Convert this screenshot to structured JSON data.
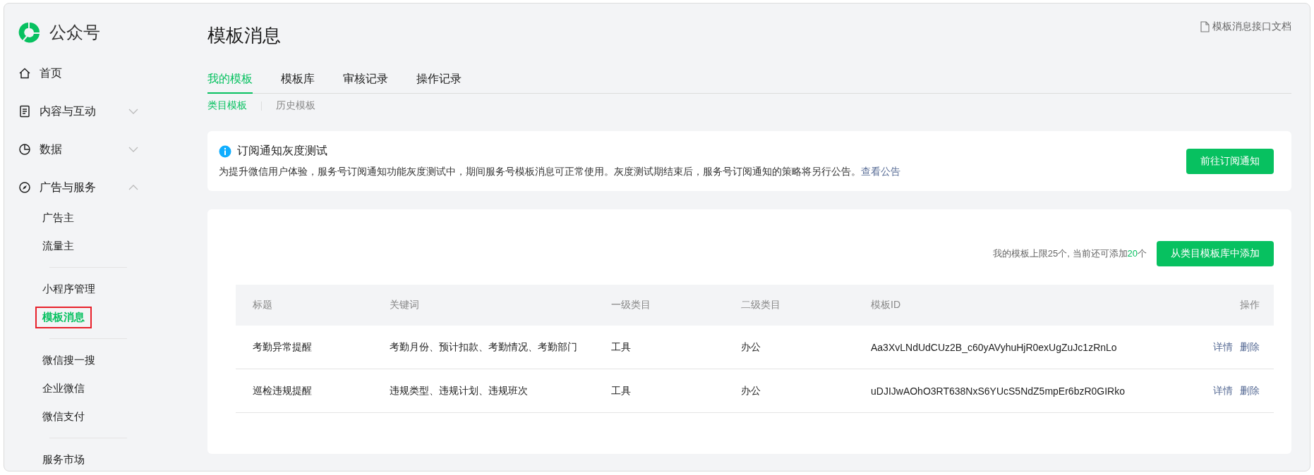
{
  "sidebar": {
    "logo": "公众号",
    "nav": [
      {
        "label": "首页"
      },
      {
        "label": "内容与互动",
        "expanded": false
      },
      {
        "label": "数据",
        "expanded": false
      },
      {
        "label": "广告与服务",
        "expanded": true,
        "groups": [
          {
            "items": [
              {
                "label": "广告主",
                "selected": false,
                "annotated": false
              },
              {
                "label": "流量主",
                "selected": false,
                "annotated": false
              }
            ]
          },
          {
            "items": [
              {
                "label": "小程序管理",
                "selected": false,
                "annotated": false
              },
              {
                "label": "模板消息",
                "selected": true,
                "annotated": true
              }
            ]
          },
          {
            "items": [
              {
                "label": "微信搜一搜",
                "selected": false,
                "annotated": false
              },
              {
                "label": "企业微信",
                "selected": false,
                "annotated": false
              },
              {
                "label": "微信支付",
                "selected": false,
                "annotated": false
              }
            ]
          },
          {
            "items": [
              {
                "label": "服务市场",
                "selected": false,
                "annotated": false
              }
            ]
          }
        ]
      }
    ]
  },
  "page": {
    "title": "模板消息",
    "doc_link": "模板消息接口文档"
  },
  "tabs": [
    {
      "label": "我的模板",
      "selected": true
    },
    {
      "label": "模板库",
      "selected": false
    },
    {
      "label": "审核记录",
      "selected": false
    },
    {
      "label": "操作记录",
      "selected": false
    }
  ],
  "subtabs": [
    {
      "label": "类目模板",
      "selected": true
    },
    {
      "label": "历史模板",
      "selected": false
    }
  ],
  "notice": {
    "title": "订阅通知灰度测试",
    "text": "为提升微信用户体验，服务号订阅通知功能灰度测试中，期间服务号模板消息可正常使用。灰度测试期结束后，服务号订阅通知的策略将另行公告。",
    "link": "查看公告",
    "button": "前往订阅通知"
  },
  "quota": {
    "prefix": "我的模板上限25个, 当前还可添加",
    "count": "20",
    "suffix": "个"
  },
  "add_button": "从类目模板库中添加",
  "table": {
    "columns": [
      "标题",
      "关键词",
      "一级类目",
      "二级类目",
      "模板ID",
      "操作"
    ],
    "rows": [
      {
        "cells": [
          "考勤异常提醒",
          "考勤月份、预计扣款、考勤情况、考勤部门",
          "工具",
          "办公",
          "Aa3XvLNdUdCUz2B_c60yAVyhuHjR0exUgZuJc1zRnLo"
        ],
        "actions": [
          "详情",
          "删除"
        ]
      },
      {
        "cells": [
          "巡检违规提醒",
          "违规类型、违规计划、违规班次",
          "工具",
          "办公",
          "uDJIJwAOhO3RT638NxS6YUcS5NdZ5mpEr6bzR0GIRko"
        ],
        "actions": [
          "详情",
          "删除"
        ]
      }
    ]
  }
}
